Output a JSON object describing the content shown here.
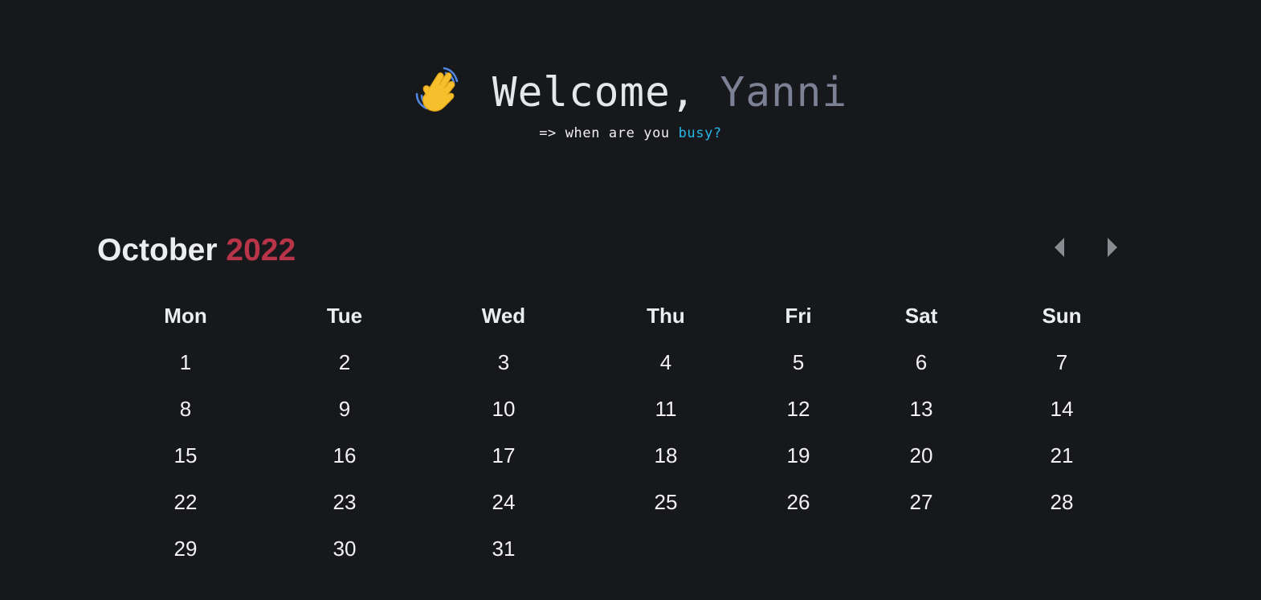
{
  "header": {
    "wave_icon": "waving-hand-icon",
    "greeting": "Welcome,",
    "user_name": "Yanni",
    "subtitle_prefix": "=> when are you",
    "subtitle_accent": "busy?"
  },
  "calendar": {
    "month": "October",
    "year": "2022",
    "prev_icon": "caret-left-icon",
    "next_icon": "caret-right-icon",
    "weekdays": [
      "Mon",
      "Tue",
      "Wed",
      "Thu",
      "Fri",
      "Sat",
      "Sun"
    ],
    "weeks": [
      [
        "1",
        "2",
        "3",
        "4",
        "5",
        "6",
        "7"
      ],
      [
        "8",
        "9",
        "10",
        "11",
        "12",
        "13",
        "14"
      ],
      [
        "15",
        "16",
        "17",
        "18",
        "19",
        "20",
        "21"
      ],
      [
        "22",
        "23",
        "24",
        "25",
        "26",
        "27",
        "28"
      ],
      [
        "29",
        "30",
        "31",
        "",
        "",
        "",
        ""
      ]
    ]
  },
  "colors": {
    "background": "#17181c",
    "year_accent": "#b83549",
    "busy_accent": "#26b7e6",
    "name_muted": "#7c8196",
    "nav_arrow": "#8a8b90"
  }
}
